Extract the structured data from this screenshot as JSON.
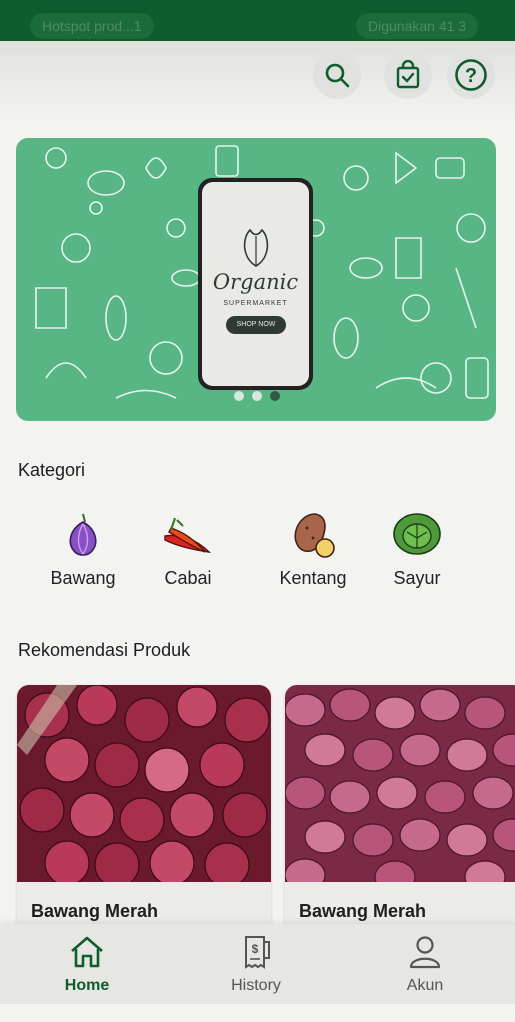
{
  "status_bar": {
    "left_text": "Hotspot prod...1",
    "right_text": "Digunakan 41 3"
  },
  "header": {
    "icons": [
      "search-icon",
      "shopping-bag-icon",
      "help-icon"
    ]
  },
  "banner": {
    "brand": "Organic",
    "subtitle": "SUPERMARKET",
    "cta": "SHOP NOW",
    "slides": 3,
    "active_slide": 3
  },
  "categories": {
    "title": "Kategori",
    "items": [
      {
        "label": "Bawang",
        "icon": "onion-icon"
      },
      {
        "label": "Cabai",
        "icon": "chili-icon"
      },
      {
        "label": "Kentang",
        "icon": "potato-icon"
      },
      {
        "label": "Sayur",
        "icon": "cabbage-icon"
      }
    ]
  },
  "recommendations": {
    "title": "Rekomendasi Produk",
    "items": [
      {
        "name": "Bawang Merah"
      },
      {
        "name": "Bawang Merah"
      }
    ]
  },
  "bottom_nav": {
    "items": [
      {
        "label": "Home",
        "icon": "home-icon",
        "active": true
      },
      {
        "label": "History",
        "icon": "receipt-icon",
        "active": false
      },
      {
        "label": "Akun",
        "icon": "user-icon",
        "active": false
      }
    ]
  },
  "colors": {
    "primary": "#0f5c2e",
    "banner": "#58b584",
    "active_nav": "#0f5c2e",
    "inactive_nav": "#555555"
  }
}
